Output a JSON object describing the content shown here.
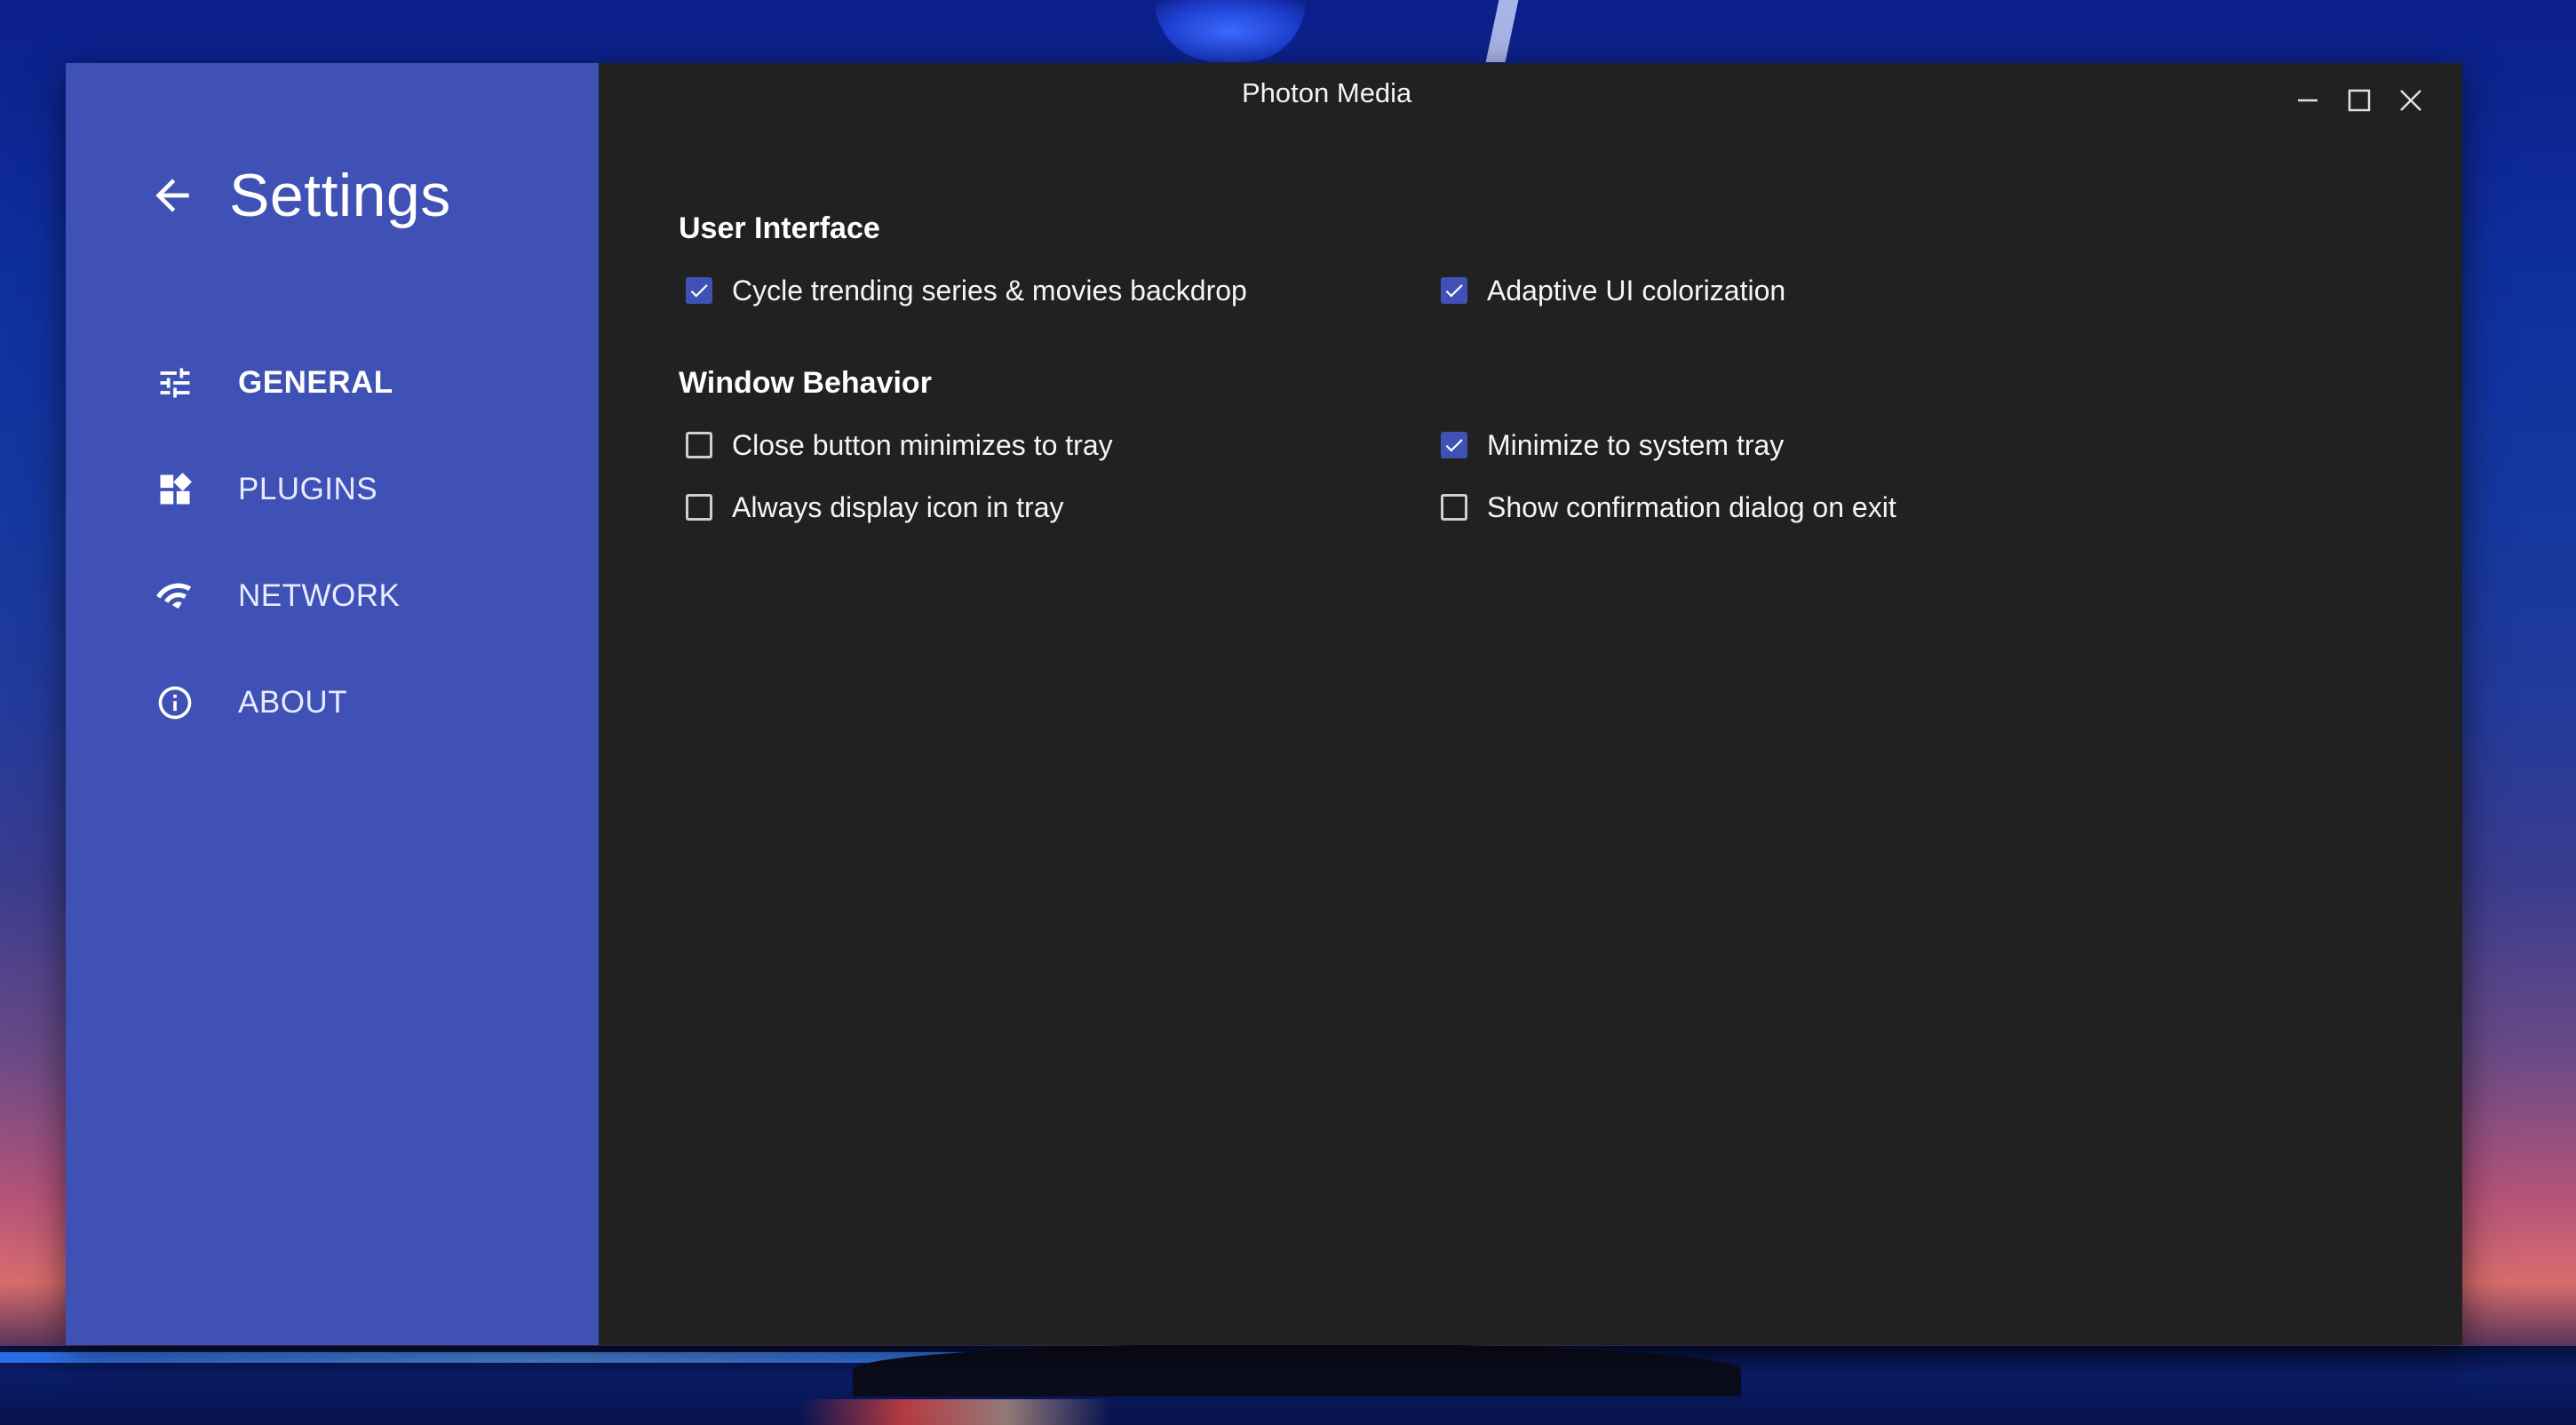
{
  "window": {
    "title": "Photon Media"
  },
  "sidebar": {
    "title": "Settings",
    "items": [
      {
        "label": "GENERAL",
        "icon": "tune-icon",
        "active": true
      },
      {
        "label": "PLUGINS",
        "icon": "widgets-icon",
        "active": false
      },
      {
        "label": "NETWORK",
        "icon": "wifi-icon",
        "active": false
      },
      {
        "label": "ABOUT",
        "icon": "info-icon",
        "active": false
      }
    ]
  },
  "sections": [
    {
      "title": "User Interface",
      "options": [
        {
          "label": "Cycle trending series & movies backdrop",
          "checked": true
        },
        {
          "label": "Adaptive UI colorization",
          "checked": true
        }
      ]
    },
    {
      "title": "Window Behavior",
      "options": [
        {
          "label": "Close button minimizes to tray",
          "checked": false
        },
        {
          "label": "Minimize to system tray",
          "checked": true
        },
        {
          "label": "Always display icon in tray",
          "checked": false
        },
        {
          "label": "Show confirmation dialog on exit",
          "checked": false
        }
      ]
    }
  ],
  "colors": {
    "accent": "#3f51b5",
    "sidebar_bg": "#3f51b5",
    "content_bg": "#212121"
  }
}
